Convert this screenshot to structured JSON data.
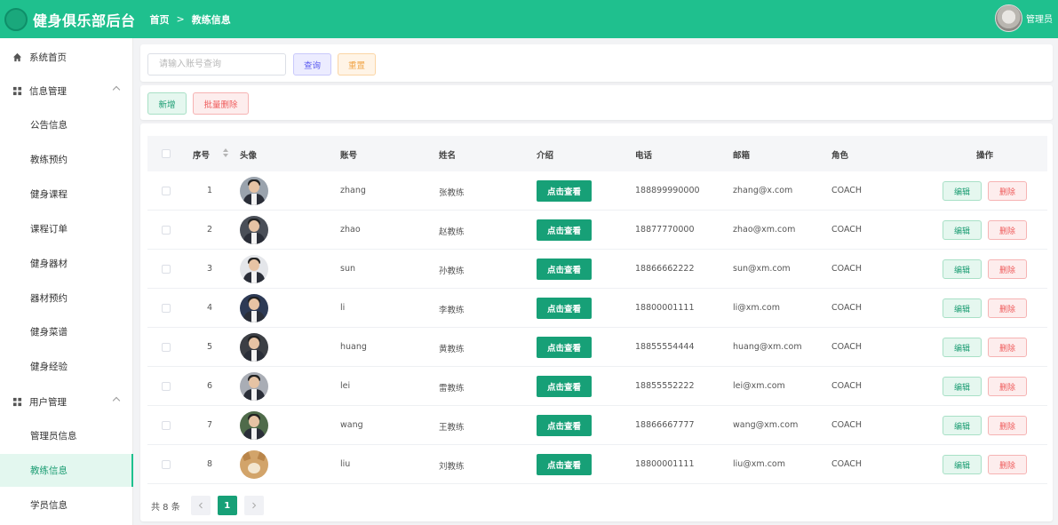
{
  "app": {
    "title": "健身俱乐部后台"
  },
  "breadcrumb": [
    "首页",
    "教练信息"
  ],
  "user": {
    "name": "管理员"
  },
  "sidebar": {
    "items": [
      {
        "label": "系统首页",
        "type": "top",
        "icon": "home-icon"
      },
      {
        "label": "信息管理",
        "type": "group",
        "icon": "grid-icon"
      },
      {
        "label": "公告信息",
        "type": "sub"
      },
      {
        "label": "教练预约",
        "type": "sub"
      },
      {
        "label": "健身课程",
        "type": "sub"
      },
      {
        "label": "课程订单",
        "type": "sub"
      },
      {
        "label": "健身器材",
        "type": "sub"
      },
      {
        "label": "器材预约",
        "type": "sub"
      },
      {
        "label": "健身菜谱",
        "type": "sub"
      },
      {
        "label": "健身经验",
        "type": "sub"
      },
      {
        "label": "用户管理",
        "type": "group",
        "icon": "grid-icon"
      },
      {
        "label": "管理员信息",
        "type": "sub"
      },
      {
        "label": "教练信息",
        "type": "sub",
        "active": true
      },
      {
        "label": "学员信息",
        "type": "sub"
      }
    ]
  },
  "search": {
    "placeholder": "请输入账号查询",
    "query_label": "查询",
    "reset_label": "重置"
  },
  "actions": {
    "add_label": "新增",
    "batch_delete_label": "批量删除"
  },
  "table": {
    "headers": {
      "index": "序号",
      "avatar": "头像",
      "account": "账号",
      "name": "姓名",
      "intro": "介绍",
      "phone": "电话",
      "email": "邮箱",
      "role": "角色",
      "ops": "操作"
    },
    "view_label": "点击查看",
    "edit_label": "编辑",
    "delete_label": "删除",
    "rows": [
      {
        "index": "1",
        "account": "zhang",
        "name": "张教练",
        "phone": "188899990000",
        "email": "zhang@x.com",
        "role": "COACH"
      },
      {
        "index": "2",
        "account": "zhao",
        "name": "赵教练",
        "phone": "18877770000",
        "email": "zhao@xm.com",
        "role": "COACH"
      },
      {
        "index": "3",
        "account": "sun",
        "name": "孙教练",
        "phone": "18866662222",
        "email": "sun@xm.com",
        "role": "COACH"
      },
      {
        "index": "4",
        "account": "li",
        "name": "李教练",
        "phone": "18800001111",
        "email": "li@xm.com",
        "role": "COACH"
      },
      {
        "index": "5",
        "account": "huang",
        "name": "黄教练",
        "phone": "18855554444",
        "email": "huang@xm.com",
        "role": "COACH"
      },
      {
        "index": "6",
        "account": "lei",
        "name": "雷教练",
        "phone": "18855552222",
        "email": "lei@xm.com",
        "role": "COACH"
      },
      {
        "index": "7",
        "account": "wang",
        "name": "王教练",
        "phone": "18866667777",
        "email": "wang@xm.com",
        "role": "COACH"
      },
      {
        "index": "8",
        "account": "liu",
        "name": "刘教练",
        "phone": "18800001111",
        "email": "liu@xm.com",
        "role": "COACH"
      }
    ]
  },
  "pagination": {
    "total_label": "共 8 条",
    "current_page": "1",
    "prev_icon": "chevron-left-icon",
    "next_icon": "chevron-right-icon"
  },
  "colors": {
    "brand": "#1fc08e",
    "view_button": "#17a077",
    "danger": "#ef5b5b"
  }
}
